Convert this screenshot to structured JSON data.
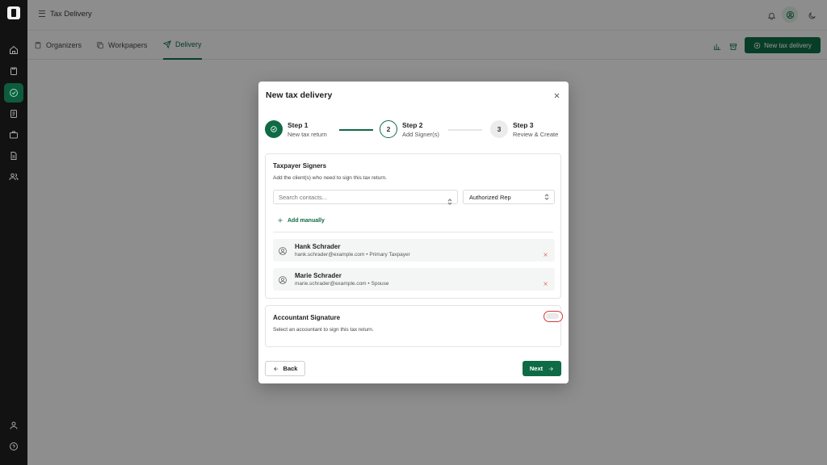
{
  "colors": {
    "brand": "#0f6b45",
    "danger": "#d33a3a",
    "sidebar_bg": "#121212"
  },
  "header": {
    "title": "Tax Delivery",
    "icons": [
      "menu-icon",
      "bell-icon",
      "user-circle-icon",
      "moon-icon"
    ]
  },
  "sidebar": {
    "items": [
      {
        "name": "home-icon"
      },
      {
        "name": "clipboard-icon"
      },
      {
        "name": "send-icon",
        "active": true
      },
      {
        "name": "document-icon"
      },
      {
        "name": "briefcase-icon"
      },
      {
        "name": "file-icon"
      },
      {
        "name": "users-icon"
      }
    ],
    "bottom": [
      {
        "name": "user-icon"
      },
      {
        "name": "help-icon"
      }
    ]
  },
  "tabs": [
    {
      "label": "Organizers",
      "icon": "clipboard-icon"
    },
    {
      "label": "Workpapers",
      "icon": "copy-icon"
    },
    {
      "label": "Delivery",
      "icon": "send-icon",
      "active": true
    }
  ],
  "toolbar": {
    "new_button_label": "New tax delivery"
  },
  "modal": {
    "title": "New tax delivery",
    "steps": [
      {
        "number": "1",
        "title": "Step 1",
        "subtitle": "New tax return",
        "state": "done"
      },
      {
        "number": "2",
        "title": "Step 2",
        "subtitle": "Add Signer(s)",
        "state": "current"
      },
      {
        "number": "3",
        "title": "Step 3",
        "subtitle": "Review & Create",
        "state": "future"
      }
    ],
    "taxpayer": {
      "title": "Taxpayer Signers",
      "subtitle": "Add the client(s) who need to sign this tax return.",
      "search_placeholder": "Search contacts...",
      "role_value": "Authorized Rep",
      "add_manually": "Add manually",
      "signers": [
        {
          "name": "Hank Schrader",
          "meta": "hank.schrader@example.com • Primary Taxpayer"
        },
        {
          "name": "Marie Schrader",
          "meta": "marie.schrader@example.com • Spouse"
        }
      ]
    },
    "accountant": {
      "title": "Accountant Signature",
      "subtitle": "Select an accountant to sign this tax return.",
      "toggle_on": false
    },
    "back_label": "Back",
    "next_label": "Next"
  }
}
